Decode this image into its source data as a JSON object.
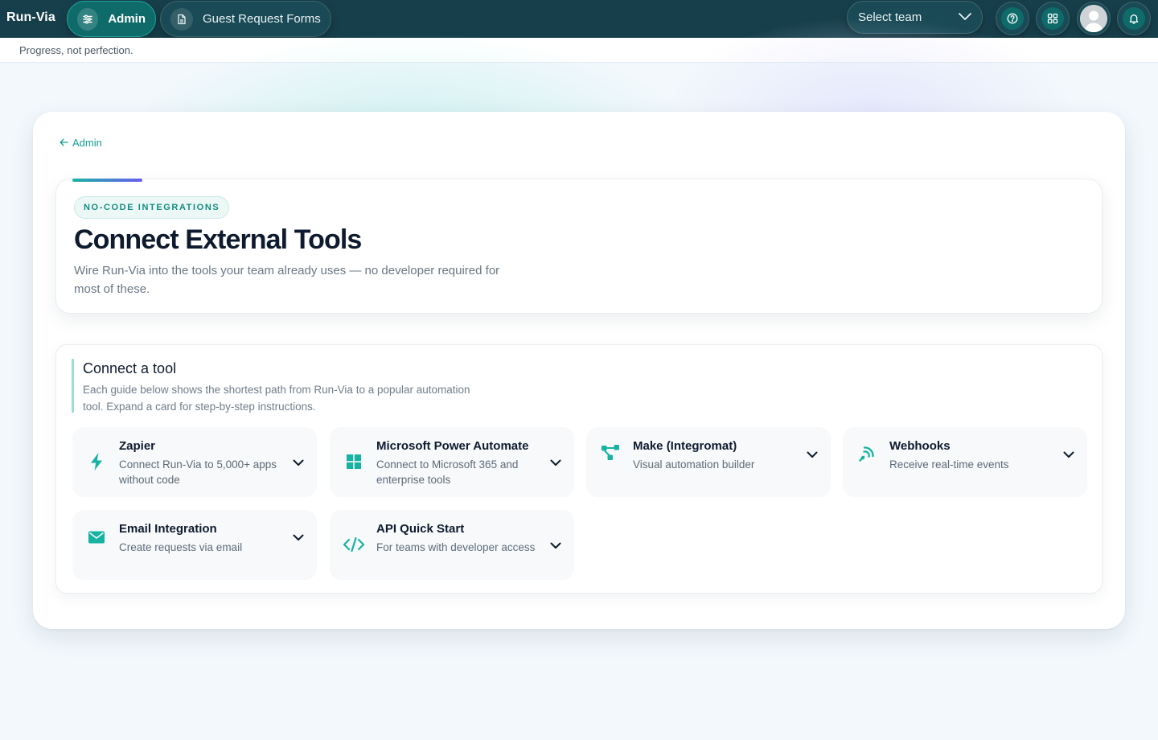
{
  "app": {
    "brand": "Run-Via",
    "tagline": "Progress, not perfection."
  },
  "nav": {
    "admin_label": "Admin",
    "forms_label": "Guest Request Forms",
    "team_select": "Select team"
  },
  "breadcrumb": {
    "back_label": "Admin"
  },
  "hero": {
    "badge": "NO-CODE INTEGRATIONS",
    "title": "Connect External Tools",
    "description": "Wire Run-Via into the tools your team already uses — no developer required for most of these."
  },
  "tools_section": {
    "title": "Connect a tool",
    "subtitle": "Each guide below shows the shortest path from Run-Via to a popular automation tool. Expand a card for step-by-step instructions.",
    "items": [
      {
        "title": "Zapier",
        "description": "Connect Run-Via to 5,000+ apps without code",
        "icon": "lightning-icon"
      },
      {
        "title": "Microsoft Power Automate",
        "description": "Connect to Microsoft 365 and enterprise tools",
        "icon": "windows-grid-icon"
      },
      {
        "title": "Make (Integromat)",
        "description": "Visual automation builder",
        "icon": "flow-nodes-icon"
      },
      {
        "title": "Webhooks",
        "description": "Receive real-time events",
        "icon": "webhook-icon"
      },
      {
        "title": "Email Integration",
        "description": "Create requests via email",
        "icon": "envelope-icon"
      },
      {
        "title": "API Quick Start",
        "description": "For teams with developer access",
        "icon": "code-icon"
      }
    ]
  },
  "colors": {
    "topbar": "#173f4b",
    "accent": "#149c8f",
    "icon": "#16b3a3"
  }
}
